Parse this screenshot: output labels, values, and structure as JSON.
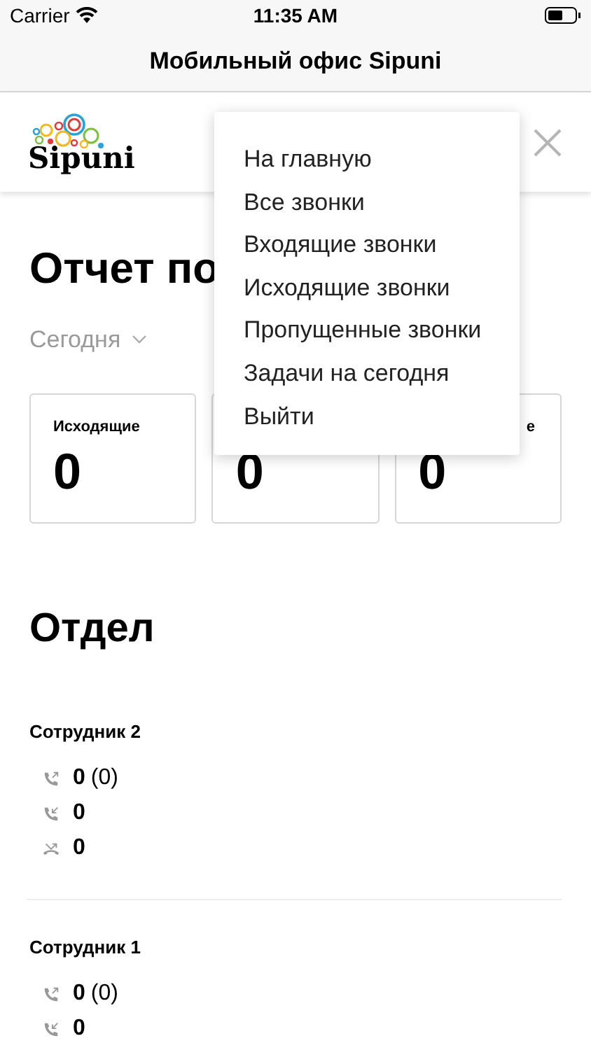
{
  "status_bar": {
    "carrier": "Carrier",
    "time": "11:35 AM"
  },
  "nav_bar": {
    "title": "Мобильный офис Sipuni"
  },
  "header": {
    "logo_text": "Sipuni"
  },
  "menu": {
    "items": [
      {
        "label": "На главную"
      },
      {
        "label": "Все звонки"
      },
      {
        "label": "Входящие звонки"
      },
      {
        "label": "Исходящие звонки"
      },
      {
        "label": "Пропущенные звонки"
      },
      {
        "label": "Задачи на сегодня"
      },
      {
        "label": "Выйти"
      }
    ]
  },
  "report": {
    "title": "Отчет по",
    "period": "Сегодня",
    "cards": [
      {
        "kind": "full",
        "label": "Исходящие",
        "value": "0"
      },
      {
        "kind": "hidden",
        "value": "0"
      },
      {
        "kind": "cut",
        "label": "е",
        "value": "0"
      }
    ]
  },
  "department": {
    "title": "Отдел",
    "employees": [
      {
        "name": "Сотрудник 2",
        "stats": [
          {
            "kind": "outgoing",
            "value": "0",
            "extra": "(0)"
          },
          {
            "kind": "incoming",
            "value": "0"
          },
          {
            "kind": "missed",
            "value": "0"
          }
        ]
      },
      {
        "name": "Сотрудник 1",
        "stats": [
          {
            "kind": "outgoing",
            "value": "0",
            "extra": "(0)"
          },
          {
            "kind": "incoming",
            "value": "0"
          }
        ]
      }
    ]
  }
}
